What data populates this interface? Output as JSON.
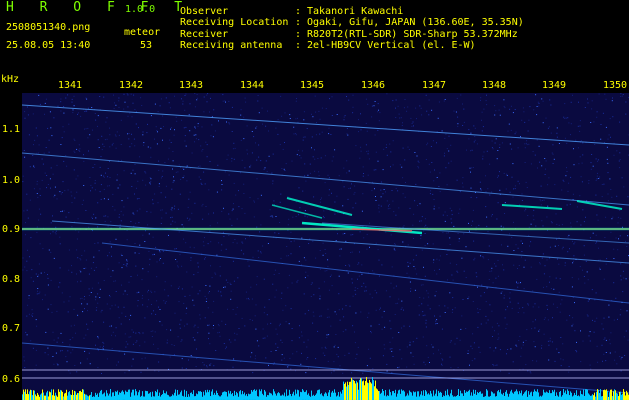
{
  "header": {
    "app_name": "H R O F F T",
    "app_version": "1.0.0",
    "file_name": "2508051340.png",
    "timestamp": "25.08.05 13:40",
    "meteor_label": "meteor",
    "meteor_count": "53",
    "observer_label": "Observer",
    "observer_value": "Takanori Kawachi",
    "location_label": "Receiving Location",
    "location_value": "Ogaki, Gifu, JAPAN (136.60E, 35.35N)",
    "receiver_label": "Receiver",
    "receiver_value": "R820T2(RTL-SDR) SDR-Sharp 53.372MHz",
    "antenna_label": "Receiving antenna",
    "antenna_value": "2el-HB9CV Vertical (el. E-W)",
    "separator": ":"
  },
  "axes": {
    "y_unit": "kHz",
    "y_ticks": [
      "1.1",
      "1.0",
      "0.9",
      "0.8",
      "0.7",
      "0.6"
    ],
    "x_ticks": [
      "1341",
      "1342",
      "1343",
      "1344",
      "1345",
      "1346",
      "1347",
      "1348",
      "1349",
      "1350"
    ]
  },
  "colors": {
    "background": "#0a0a40",
    "text_yellow": "#ffff00",
    "text_green": "#7fff00",
    "meteor_signal": "#00ffd0",
    "carrier": "#ffff80"
  }
}
